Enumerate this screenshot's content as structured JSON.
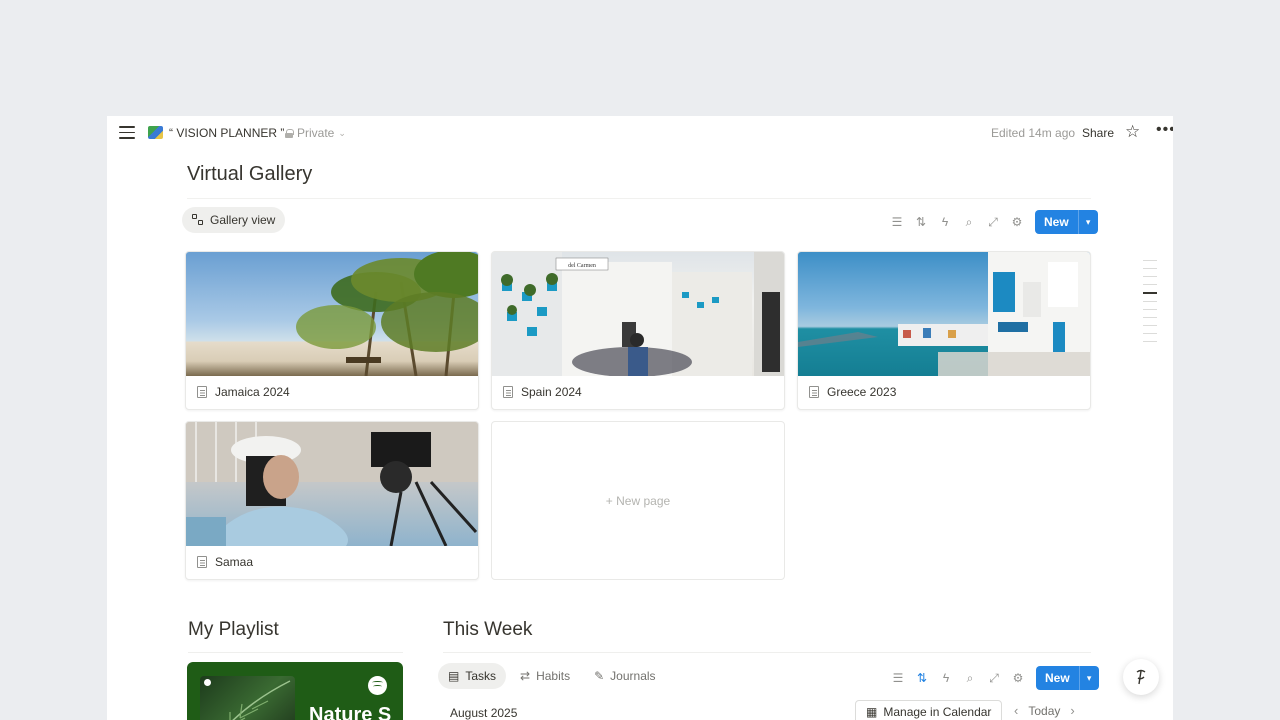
{
  "topbar": {
    "page_title": "“ VISION PLANNER ”",
    "privacy": "Private",
    "edited": "Edited 14m ago",
    "share": "Share"
  },
  "gallery": {
    "heading": "Virtual Gallery",
    "view_label": "Gallery view",
    "new_label": "New",
    "new_page": "+ New page",
    "cards": [
      {
        "title": "Jamaica 2024"
      },
      {
        "title": "Spain 2024"
      },
      {
        "title": "Greece 2023"
      },
      {
        "title": "Samaa"
      }
    ],
    "spain_sign": "del Carmen"
  },
  "playlist": {
    "heading": "My Playlist",
    "name": "Nature S"
  },
  "week": {
    "heading": "This Week",
    "tabs": [
      {
        "label": "Tasks",
        "icon": "table-icon"
      },
      {
        "label": "Habits",
        "icon": "repeat-icon"
      },
      {
        "label": "Journals",
        "icon": "edit-icon"
      }
    ],
    "new_label": "New",
    "month": "August 2025",
    "manage": "Manage in Calendar",
    "today": "Today"
  },
  "colors": {
    "accent": "#2383e2",
    "spotify_green": "#1f5c16"
  }
}
